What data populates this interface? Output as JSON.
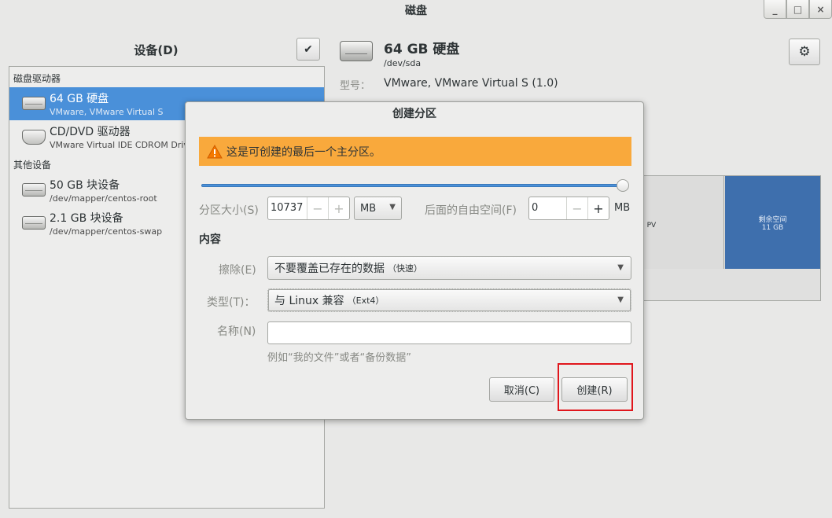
{
  "window": {
    "title": "磁盘",
    "controls": [
      "_",
      "□",
      "×"
    ]
  },
  "left_pane": {
    "title": "设备(D)",
    "sections": [
      {
        "label": "磁盘驱动器",
        "items": [
          {
            "title": "64 GB 硬盘",
            "subtitle": "VMware, VMware Virtual S",
            "icon": "hard-drive-icon",
            "selected": true
          },
          {
            "title": "CD/DVD 驱动器",
            "subtitle": "VMware Virtual IDE CDROM Drive",
            "icon": "optical-drive-icon",
            "selected": false
          }
        ]
      },
      {
        "label": "其他设备",
        "items": [
          {
            "title": "50 GB 块设备",
            "subtitle": "/dev/mapper/centos-root",
            "icon": "block-device-icon",
            "selected": false
          },
          {
            "title": "2.1 GB 块设备",
            "subtitle": "/dev/mapper/centos-swap",
            "icon": "block-device-icon",
            "selected": false
          }
        ]
      }
    ]
  },
  "right_pane": {
    "disk_title": "64 GB 硬盘",
    "disk_path": "/dev/sda",
    "model_label": "型号：",
    "model_value": "VMware, VMware Virtual S (1.0)",
    "volume_map": {
      "partial_label": "2 PV",
      "free_label": "剩余空间",
      "free_size": "11 GB"
    }
  },
  "dialog": {
    "title": "创建分区",
    "warning": "这是可创建的最后一个主分区。",
    "size_label": "分区大小(S)",
    "size_value": "10737",
    "size_unit": "MB",
    "free_after_label": "后面的自由空间(F)",
    "free_after_value": "0",
    "free_after_unit": "MB",
    "size_fraction": 1.0,
    "content_heading": "内容",
    "erase_label": "擦除(E)",
    "erase_value": "不要覆盖已存在的数据",
    "erase_note": "（快速）",
    "type_label": "类型(T)：",
    "type_value": "与 Linux 兼容",
    "type_note": "（Ext4）",
    "name_label": "名称(N)",
    "name_value": "",
    "name_hint": "例如“我的文件”或者“备份数据”",
    "cancel_label": "取消(C)",
    "create_label": "创建(R)"
  },
  "colors": {
    "selection": "#4a90d9",
    "warning": "#f9a93c",
    "free_space": "#3e6fad",
    "highlight_box": "#e0161c"
  }
}
